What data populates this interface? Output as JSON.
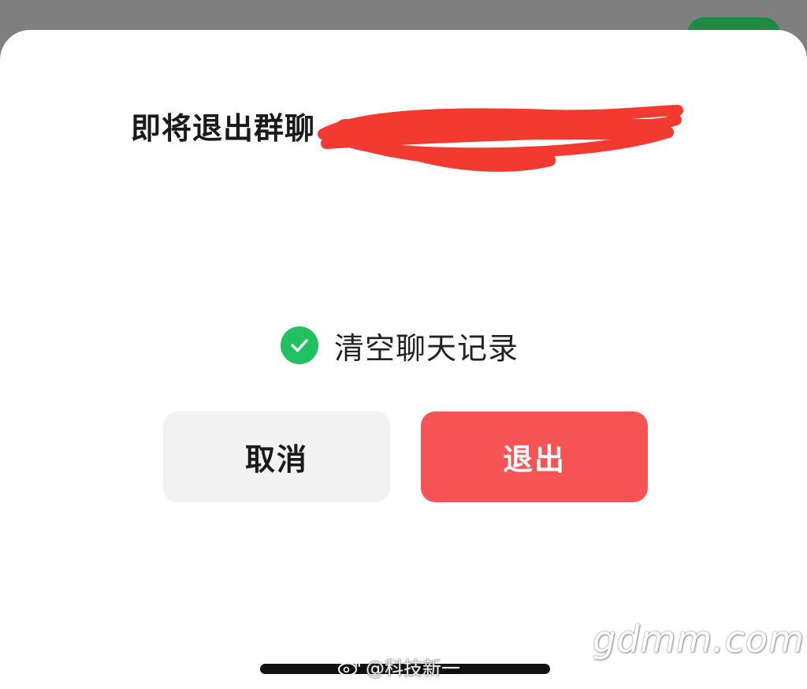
{
  "dialog": {
    "title": "即将退出群聊",
    "option_label": "清空聊天记录",
    "option_checked": true,
    "cancel_label": "取消",
    "exit_label": "退出"
  },
  "colors": {
    "accent_green": "#21c15f",
    "danger_red": "#f65454",
    "cancel_bg": "#f2f2f2",
    "redaction_red": "#f23a30"
  },
  "watermarks": {
    "weibo": "@科技新一",
    "site": "gdmm.com"
  }
}
